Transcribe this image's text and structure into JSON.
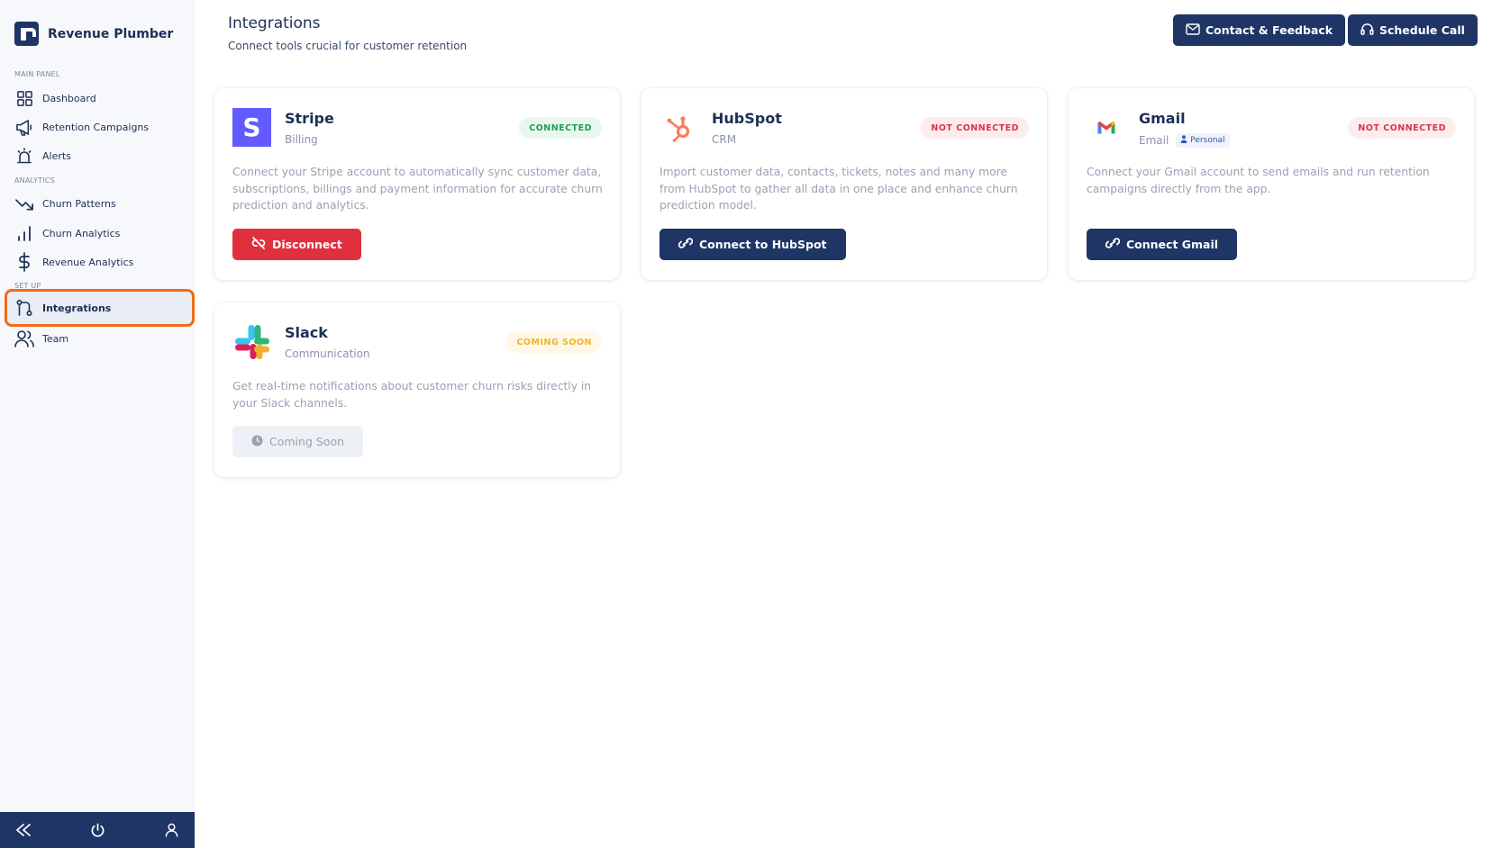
{
  "app": {
    "name": "Revenue Plumber"
  },
  "sidebar": {
    "sections": {
      "main": "MAIN PANEL",
      "analytics": "ANALYTICS",
      "setup": "SET UP"
    },
    "items": [
      {
        "label": "Dashboard",
        "icon": "dashboard-grid-icon"
      },
      {
        "label": "Retention Campaigns",
        "icon": "megaphone-icon"
      },
      {
        "label": "Alerts",
        "icon": "siren-icon"
      },
      {
        "label": "Churn Patterns",
        "icon": "trend-down-icon"
      },
      {
        "label": "Churn Analytics",
        "icon": "bar-chart-icon"
      },
      {
        "label": "Revenue Analytics",
        "icon": "dollar-icon"
      },
      {
        "label": "Integrations",
        "icon": "git-pull-icon",
        "active": true
      },
      {
        "label": "Team",
        "icon": "users-icon"
      }
    ],
    "footer": {
      "collapse": "collapse-icon",
      "power": "power-icon",
      "user": "user-icon"
    }
  },
  "header": {
    "title": "Integrations",
    "subtitle": "Connect tools crucial for customer retention",
    "contact_label": "Contact & Feedback",
    "schedule_label": "Schedule Call"
  },
  "integrations": [
    {
      "name": "Stripe",
      "category": "Billing",
      "status": "CONNECTED",
      "description": "Connect your Stripe account to automatically sync customer data, subscriptions, billings and payment information for accurate churn prediction and analytics.",
      "action": "Disconnect"
    },
    {
      "name": "HubSpot",
      "category": "CRM",
      "status": "NOT CONNECTED",
      "description": "Import customer data, contacts, tickets, notes and many more from HubSpot to gather all data in one place and enhance churn prediction model.",
      "action": "Connect to HubSpot"
    },
    {
      "name": "Gmail",
      "category": "Email",
      "tag": "Personal",
      "status": "NOT CONNECTED",
      "description": "Connect your Gmail account to send emails and run retention campaigns directly from the app.",
      "action": "Connect Gmail"
    },
    {
      "name": "Slack",
      "category": "Communication",
      "status": "COMING SOON",
      "description": "Get real-time notifications about customer churn risks directly in your Slack channels.",
      "action": "Coming Soon"
    }
  ],
  "colors": {
    "primary": "#1e3566",
    "danger": "#e0303e",
    "active_outline": "#f26a1b",
    "connected_bg": "#e9f7ee",
    "connected_fg": "#1f9d55",
    "not_connected_bg": "#fdecee",
    "not_connected_fg": "#d93646",
    "coming_soon_bg": "#fff8e6",
    "coming_soon_fg": "#f0b429"
  }
}
